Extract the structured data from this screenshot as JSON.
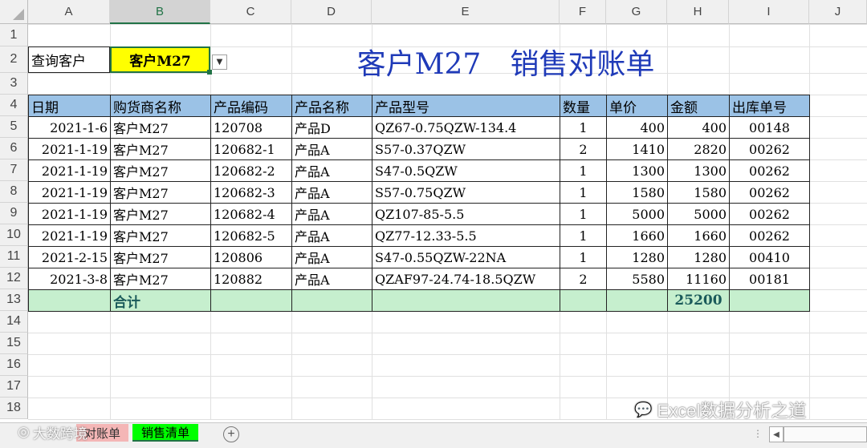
{
  "columns": [
    "A",
    "B",
    "C",
    "D",
    "E",
    "F",
    "G",
    "H",
    "I",
    "J"
  ],
  "rows": [
    "1",
    "2",
    "3",
    "4",
    "5",
    "6",
    "7",
    "8",
    "9",
    "10",
    "11",
    "12",
    "13",
    "14",
    "15",
    "16",
    "17",
    "18"
  ],
  "query": {
    "label": "查询客户",
    "value": "客户M27"
  },
  "title": "客户M27　销售对账单",
  "table": {
    "headers": [
      "日期",
      "购货商名称",
      "产品编码",
      "产品名称",
      "产品型号",
      "数量",
      "单价",
      "金额",
      "出库单号"
    ],
    "rows": [
      [
        "2021-1-6",
        "客户M27",
        "120708",
        "产品D",
        "QZ67-0.75QZW-134.4",
        "1",
        "400",
        "400",
        "00148"
      ],
      [
        "2021-1-19",
        "客户M27",
        "120682-1",
        "产品A",
        "S57-0.37QZW",
        "2",
        "1410",
        "2820",
        "00262"
      ],
      [
        "2021-1-19",
        "客户M27",
        "120682-2",
        "产品A",
        "S47-0.5QZW",
        "1",
        "1300",
        "1300",
        "00262"
      ],
      [
        "2021-1-19",
        "客户M27",
        "120682-3",
        "产品A",
        "S57-0.75QZW",
        "1",
        "1580",
        "1580",
        "00262"
      ],
      [
        "2021-1-19",
        "客户M27",
        "120682-4",
        "产品A",
        "QZ107-85-5.5",
        "1",
        "5000",
        "5000",
        "00262"
      ],
      [
        "2021-1-19",
        "客户M27",
        "120682-5",
        "产品A",
        "QZ77-12.33-5.5",
        "1",
        "1660",
        "1660",
        "00262"
      ],
      [
        "2021-2-15",
        "客户M27",
        "120806",
        "产品A",
        "S47-0.55QZW-22NA",
        "1",
        "1280",
        "1280",
        "00410"
      ],
      [
        "2021-3-8",
        "客户M27",
        "120882",
        "产品A",
        "QZAF97-24.74-18.5QZW",
        "2",
        "5580",
        "11160",
        "00181"
      ]
    ],
    "total_label": "合计",
    "total_value": "25200"
  },
  "tabs": [
    {
      "label": "对账单",
      "color": "#f4b6b6"
    },
    {
      "label": "销售清单",
      "color": "#00ff00"
    }
  ],
  "watermark_left": "大数跨境",
  "watermark_right": "Excel数据分析之道",
  "colors": {
    "header_fill": "#9bc2e6",
    "total_fill": "#c6efce",
    "query_fill": "#ffff00",
    "title": "#1f3ab8"
  }
}
